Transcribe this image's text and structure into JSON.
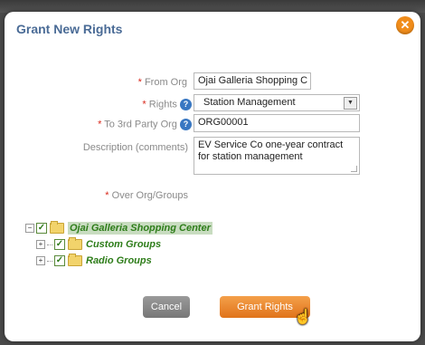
{
  "dialog": {
    "title": "Grant New Rights",
    "close_glyph": "✕"
  },
  "form": {
    "required_mark": "*",
    "help_glyph": "?",
    "from_org": {
      "label": "From Org",
      "value": "Ojai Galleria Shopping C"
    },
    "rights": {
      "label": "Rights",
      "value": "Station Management"
    },
    "to_org": {
      "label": "To 3rd Party Org",
      "value": "ORG00001"
    },
    "description": {
      "label": "Description (comments)",
      "value": "EV Service Co one-year contract for station management"
    },
    "over_groups": {
      "label": "Over Org/Groups"
    }
  },
  "tree": {
    "root": {
      "label": "Ojai Galleria Shopping Center",
      "expander": "−",
      "checked": true
    },
    "children": [
      {
        "label": "Custom Groups",
        "expander": "+",
        "checked": true
      },
      {
        "label": "Radio Groups",
        "expander": "+",
        "checked": true
      }
    ]
  },
  "buttons": {
    "cancel": "Cancel",
    "grant": "Grant Rights"
  },
  "colors": {
    "title": "#4a6b96",
    "accent": "#f08c1a",
    "required": "#d9281b",
    "tree_label": "#2e7d1a"
  },
  "icons": {
    "close": "close-icon",
    "help": "help-icon",
    "folder": "folder-icon",
    "checkbox": "checkbox-checked-icon",
    "dropdown": "chevron-down-icon",
    "cursor": "hand-cursor-icon"
  }
}
